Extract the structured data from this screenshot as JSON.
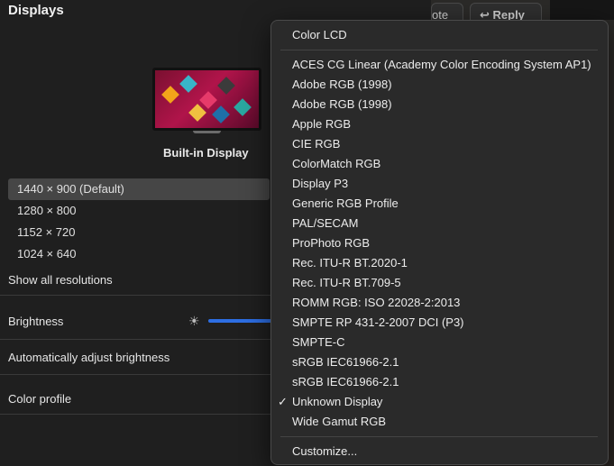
{
  "background_app": {
    "note_button": "ote",
    "reply_button": "↩ Reply"
  },
  "panel": {
    "title": "Displays",
    "display_name": "Built-in Display",
    "resolutions": [
      "1440 × 900 (Default)",
      "1280 × 800",
      "1152 × 720",
      "1024 × 640"
    ],
    "show_all": "Show all resolutions",
    "brightness_label": "Brightness",
    "auto_brightness_label": "Automatically adjust brightness",
    "color_profile_label": "Color profile",
    "sun_icon": "sun-icon"
  },
  "menu": {
    "current": "Color LCD",
    "items": [
      "ACES CG Linear (Academy Color Encoding System AP1)",
      "Adobe RGB (1998)",
      "Adobe RGB (1998)",
      "Apple RGB",
      "CIE RGB",
      "ColorMatch RGB",
      "Display P3",
      "Generic RGB Profile",
      "PAL/SECAM",
      "ProPhoto RGB",
      "Rec. ITU-R BT.2020-1",
      "Rec. ITU-R BT.709-5",
      "ROMM RGB: ISO 22028-2:2013",
      "SMPTE RP 431-2-2007 DCI (P3)",
      "SMPTE-C",
      "sRGB IEC61966-2.1",
      "sRGB IEC61966-2.1",
      "Unknown Display",
      "Wide Gamut RGB"
    ],
    "checked_item": "Unknown Display",
    "check_mark": "✓",
    "customize": "Customize..."
  },
  "colors": {
    "accent": "#2d6ee3",
    "selected_row": "#464646"
  }
}
